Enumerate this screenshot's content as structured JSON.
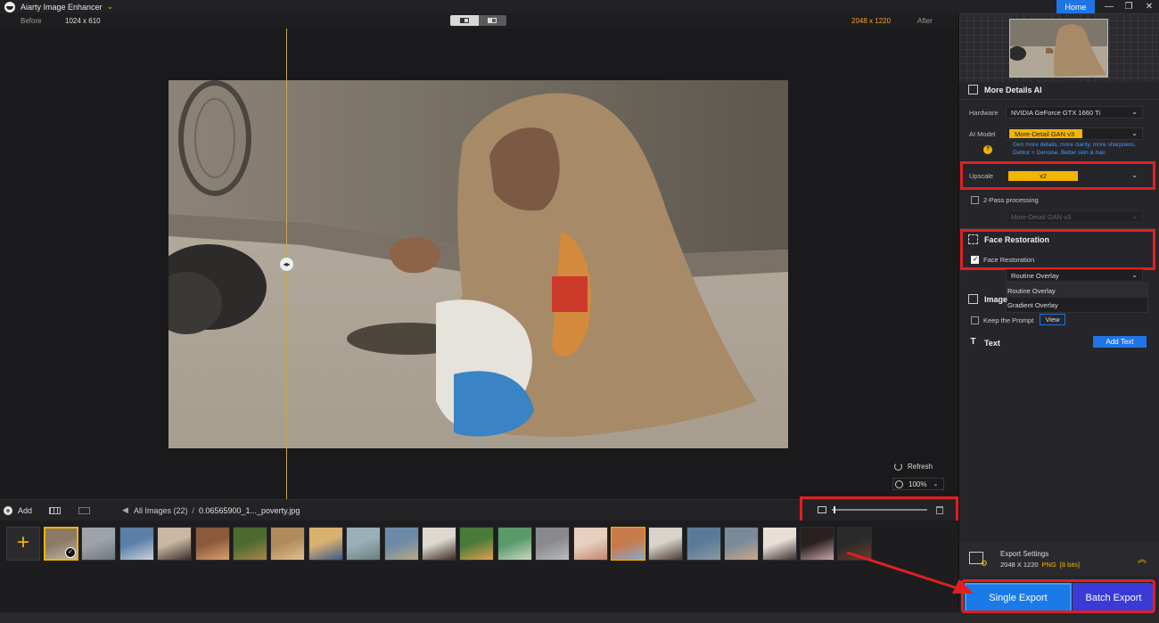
{
  "app": {
    "title": "Aiarty Image Enhancer",
    "home_label": "Home"
  },
  "compare": {
    "before_label": "Before",
    "after_label": "After",
    "before_size": "1024 x 610",
    "after_size": "2048 x 1220"
  },
  "canvas": {
    "refresh_label": "Refresh",
    "zoom_value": "100%"
  },
  "toolbar": {
    "add_label": "Add",
    "breadcrumb_all": "All Images (22)",
    "breadcrumb_sep": "/",
    "breadcrumb_file": "0.06565900_1..._poverty.jpg",
    "thumb_size_fraction": 0.02
  },
  "filmstrip": {
    "count": 22,
    "selected_index": 0
  },
  "panel": {
    "section_title": "More Details AI",
    "hardware_label": "Hardware",
    "hardware_value": "NVIDIA GeForce GTX 1660 Ti",
    "model_label": "AI Model",
    "model_value": "More-Detail GAN  v3",
    "model_desc_1": "Gen more details, more clarity, more sharpness.",
    "model_desc_2": "Deblur + Denoise. Better skin & hair.",
    "upscale_label": "Upscale",
    "upscale_value": "x2",
    "two_pass_label": "2-Pass processing",
    "two_pass_model": "More-Detail GAN  v3",
    "face_title": "Face Restoration",
    "face_check_label": "Face Restoration",
    "overlay_value": "Routine Overlay",
    "overlay_options": [
      "Routine Overlay",
      "Gradient Overlay"
    ],
    "image_section_title": "Image",
    "keep_prompt_label": "Keep the Prompt",
    "view_label": "View",
    "text_title": "Text",
    "add_text_label": "Add Text"
  },
  "export": {
    "settings_title": "Export Settings",
    "size": "2048 X 1220",
    "format": "PNG",
    "bits": "[8 bits]",
    "single_label": "Single Export",
    "batch_label": "Batch Export"
  },
  "colors": {
    "accent_yellow": "#f2b500",
    "accent_blue": "#1f74e6",
    "highlight_red": "#e02020"
  }
}
